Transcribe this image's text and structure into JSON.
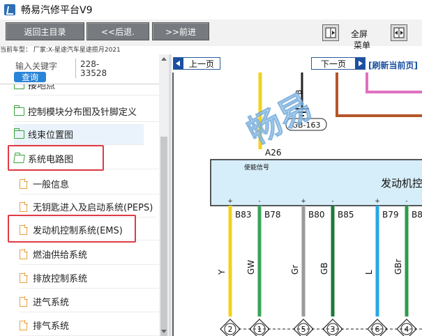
{
  "app": {
    "title": "畅易汽修平台V9"
  },
  "toolbar": {
    "home_label": "返回主目录",
    "back_label": "<<后退.",
    "forward_label": ">>前进",
    "fullscreen_label": "全屏",
    "menu_label": "菜单",
    "car_model": "当前车型： 厂家:X-星途汽车星途揽月2021"
  },
  "search": {
    "keyword_label": "输入关键字",
    "query_label": "查询",
    "keyword_value": "228-33528"
  },
  "tree": {
    "items": [
      {
        "label": "接地点",
        "kind": "folder"
      },
      {
        "label": "控制模块分布图及针脚定义",
        "kind": "folder"
      },
      {
        "label": "线束位置图",
        "kind": "folder"
      },
      {
        "label": "系统电路图",
        "kind": "folder-open"
      },
      {
        "label": "一般信息",
        "kind": "doc"
      },
      {
        "label": "无钥匙进入及启动系统(PEPS)",
        "kind": "doc"
      },
      {
        "label": "发动机控制系统(EMS)",
        "kind": "doc"
      },
      {
        "label": "燃油供给系统",
        "kind": "doc"
      },
      {
        "label": "排放控制系统",
        "kind": "doc"
      },
      {
        "label": "进气系统",
        "kind": "doc"
      },
      {
        "label": "排气系统",
        "kind": "doc"
      }
    ]
  },
  "diagram_nav": {
    "prev_label": "上一页",
    "next_label": "下一页",
    "refresh_label": "[刷新当前页]"
  },
  "diagram": {
    "watermark": "畅易",
    "ground_label": "GB-163",
    "connector_a26": "A26",
    "enable_signal": "使能信号",
    "ecu_label": "发动机控",
    "upper_pin_b": "B",
    "pins": [
      {
        "pin": "B83",
        "polarity": "+",
        "wire": "Y",
        "connector": "2",
        "color": "#f2d21b"
      },
      {
        "pin": "B78",
        "polarity": "-",
        "wire": "GW",
        "connector": "1",
        "color": "#3aa55a"
      },
      {
        "pin": "B80",
        "polarity": "+",
        "wire": "Gr",
        "connector": "5",
        "color": "#9a9a9a"
      },
      {
        "pin": "B85",
        "polarity": "-",
        "wire": "GB",
        "connector": "3",
        "color": "#1d7a3a"
      },
      {
        "pin": "B79",
        "polarity": "+",
        "wire": "L",
        "connector": "6",
        "color": "#2aa7e0"
      },
      {
        "pin": "B8",
        "polarity": "-",
        "wire": "GBr",
        "connector": "4",
        "color": "#2e9c4a"
      }
    ],
    "wire_colors": {
      "pink": "#e070c0",
      "brown": "#b5562a",
      "yellow": "#f2d21b",
      "black": "#222222"
    }
  }
}
